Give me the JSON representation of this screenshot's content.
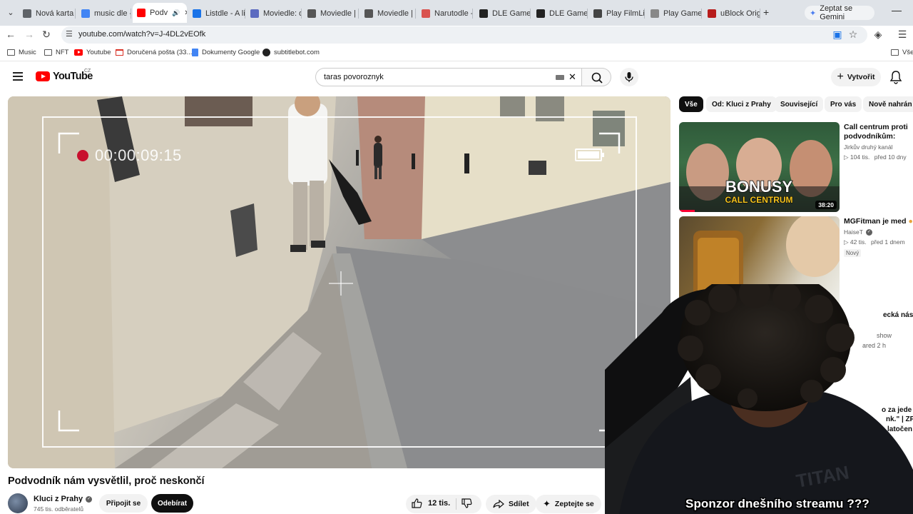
{
  "browser": {
    "tabs": [
      {
        "label": "Nová karta",
        "favicon_color": "#5f6368"
      },
      {
        "label": "music dle - ",
        "favicon_color": "#4285f4"
      },
      {
        "label": "Podv",
        "favicon_color": "#ff0000",
        "active": true
      },
      {
        "label": "Listdle - A lis",
        "favicon_color": "#1a73e8"
      },
      {
        "label": "Moviedle: de",
        "favicon_color": "#5c6bc0"
      },
      {
        "label": "Moviedle | Th",
        "favicon_color": "#555555"
      },
      {
        "label": "Moviedle | Th",
        "favicon_color": "#555555"
      },
      {
        "label": "Narutodle - ",
        "favicon_color": "#d9534f"
      },
      {
        "label": "DLE Games",
        "favicon_color": "#222222"
      },
      {
        "label": "DLE Games",
        "favicon_color": "#222222"
      },
      {
        "label": "Play FilmLink",
        "favicon_color": "#444444"
      },
      {
        "label": "Play Gamedl",
        "favicon_color": "#888888"
      },
      {
        "label": "uBlock Origi",
        "favicon_color": "#b71c1c"
      }
    ],
    "gemini_label": "Zeptat se Gemini",
    "url": "youtube.com/watch?v=J-4DL2vEOfk",
    "bookmarks": [
      {
        "label": "Music",
        "icon": "folder-icon"
      },
      {
        "label": "NFT",
        "icon": "folder-icon"
      },
      {
        "label": "Youtube",
        "icon": "youtube-icon"
      },
      {
        "label": "Doručená pošta (33...",
        "icon": "gmail-icon"
      },
      {
        "label": "Dokumenty Google",
        "icon": "docs-icon"
      },
      {
        "label": "subtitlebot.com",
        "icon": "subtitlebot-icon"
      },
      {
        "label": "Vše",
        "icon": "folder-icon"
      }
    ]
  },
  "header": {
    "logo_text": "YouTube",
    "country": "CZ",
    "search_value": "taras povoroznyk",
    "create_label": "Vytvořit"
  },
  "player": {
    "timestamp": "00:00:09:15"
  },
  "video": {
    "title": "Podvodník nám vysvětlil, proč neskončí",
    "channel": "Kluci z Prahy",
    "subscribers": "745 tis. odběratelů",
    "join_label": "Připojit se",
    "subscribe_label": "Odebírat",
    "likes": "12 tis.",
    "share_label": "Sdílet",
    "ask_label": "Zeptejte se"
  },
  "chips": [
    "Vše",
    "Od: Kluci z Prahy",
    "Související",
    "Pro vás",
    "Nově nahrán"
  ],
  "recommendations": [
    {
      "title": "Call centrum proti podvodníkům: BONUSY",
      "channel": "Jirkův druhý kanál",
      "views": "104 tis.",
      "age": "před 10 dny",
      "duration": "38:20",
      "thumb_text_top": "BONUSY",
      "thumb_text_bottom": "CALL CENTRUM"
    },
    {
      "title": "MGFitman je med",
      "channel": "HaiseT",
      "views": "42 tis.",
      "age": "před 1 dnem",
      "badge": "Nový"
    }
  ],
  "partial_right_texts": [
    "ecká nás",
    "show",
    "ared 2 h",
    "o za jede",
    "nk.\" | ZP",
    "latočen"
  ],
  "overlay": {
    "sponsor_text": "Sponzor dnešního streamu ???"
  }
}
